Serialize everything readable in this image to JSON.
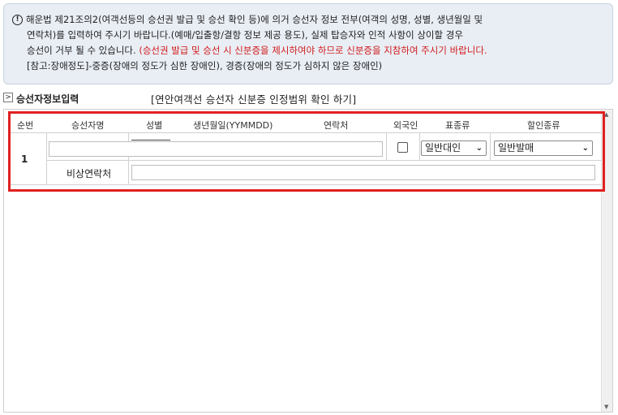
{
  "notice": {
    "line1": "해운법 제21조의2(여객선등의 승선권 발급 및 승선 확인 등)에 의거 승선자 정보 전부(여객의 성명, 성별, 생년월일 및",
    "line2": "연락처)를 입력하여 주시기 바랍니다.(예매/입출항/결항 정보 제공 용도), 실제 탑승자와 인적 사항이 상이할 경우",
    "line3_normal": "승선이 거부 될 수 있습니다.",
    "line3_red": "(승선권 발급 및 승선 시 신분증을 제시하여야 하므로 신분증을 지참하여 주시기 바랍니다.",
    "line4": "[참고:장애정도]-중증(장애의 정도가 심한 장애인), 경증(장애의 정도가 심하지 않은 장애인)"
  },
  "section": {
    "title": "승선자정보입력",
    "id_check_link": "[연안여객선 승선자 신분증 인정범위 확인 하기]"
  },
  "table": {
    "headers": {
      "seq": "순번",
      "name": "승선자명",
      "gender": "성별",
      "birth": "생년월일(YYMMDD)",
      "contact": "연락처",
      "foreigner": "외국인",
      "ticket_type": "표종류",
      "discount_type": "할인종류"
    },
    "rows": [
      {
        "seq": "1",
        "name": "",
        "gender": "",
        "birth": "",
        "contact": "",
        "ticket_type": "일반대인",
        "discount_type": "일반발매",
        "emergency_label": "비상연락처",
        "emergency_contact": ""
      }
    ]
  },
  "colors": {
    "alert_red": "#d01c1c",
    "highlight_border": "#e02020",
    "notice_bg": "#e9eef5"
  }
}
